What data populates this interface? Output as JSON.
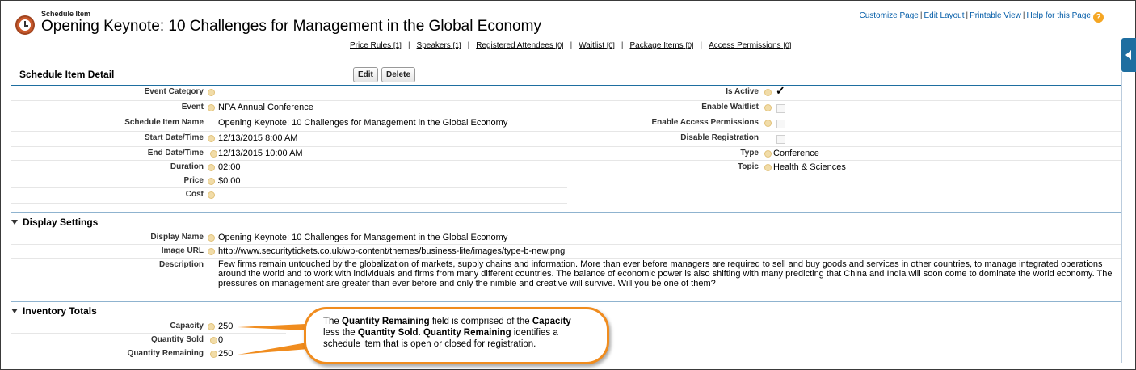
{
  "header": {
    "object_type": "Schedule Item",
    "title": "Opening Keynote: 10 Challenges for Management in the Global Economy",
    "links": [
      "Customize Page",
      "Edit Layout",
      "Printable View",
      "Help for this Page"
    ],
    "help_icon": "?"
  },
  "related_lists": [
    {
      "label": "Price Rules",
      "count": "[1]"
    },
    {
      "label": "Speakers",
      "count": "[1]"
    },
    {
      "label": "Registered Attendees",
      "count": "[0]"
    },
    {
      "label": "Waitlist",
      "count": "[0]"
    },
    {
      "label": "Package Items",
      "count": "[0]"
    },
    {
      "label": "Access Permissions",
      "count": "[0]"
    }
  ],
  "detail": {
    "title": "Schedule Item Detail",
    "edit_label": "Edit",
    "delete_label": "Delete",
    "left_fields": [
      {
        "label": "Event Category",
        "value": ""
      },
      {
        "label": "Event",
        "value": "NPA Annual Conference"
      },
      {
        "label": "Schedule Item Name",
        "value": "Opening Keynote: 10 Challenges for Management in the Global Economy"
      },
      {
        "label": "Start Date/Time",
        "value": "12/13/2015 8:00 AM"
      },
      {
        "label": "End Date/Time",
        "value": "12/13/2015 10:00 AM"
      },
      {
        "label": "Duration",
        "value": "02:00"
      },
      {
        "label": "Price",
        "value": "$0.00"
      },
      {
        "label": "Cost",
        "value": ""
      }
    ],
    "right_fields": [
      {
        "label": "Is Active",
        "checked": true
      },
      {
        "label": "Enable Waitlist",
        "checked": false
      },
      {
        "label": "Enable Access Permissions",
        "checked": false
      },
      {
        "label": "Disable Registration",
        "checked": false
      },
      {
        "label": "Type",
        "value": "Conference"
      },
      {
        "label": "Topic",
        "value": "Health & Sciences"
      }
    ]
  },
  "display_settings": {
    "title": "Display Settings",
    "display_name_label": "Display Name",
    "display_name": "Opening Keynote: 10 Challenges for Management in the Global Economy",
    "image_url_label": "Image URL",
    "image_url": "http://www.securitytickets.co.uk/wp-content/themes/business-lite/images/type-b-new.png",
    "description_label": "Description",
    "description": "Few firms remain untouched by the globalization of markets, supply chains and information. More than ever before managers are required to sell and buy goods and services in other countries, to manage integrated operations around the world and to work with individuals and firms from many different countries. The balance of economic power is also shifting with many predicting that China and India will soon come to dominate the world economy. The pressures on management are greater than ever before and only the nimble and creative will survive. Will you be one of them?"
  },
  "inventory": {
    "title": "Inventory Totals",
    "capacity_label": "Capacity",
    "capacity": "250",
    "sold_label": "Quantity Sold",
    "sold": "0",
    "remaining_label": "Quantity Remaining",
    "remaining": "250"
  },
  "callout": {
    "t1": "The ",
    "b1": "Quantity Remaining",
    "t2": " field is comprised of the ",
    "b2": "Capacity",
    "t3": " less the ",
    "b3": "Quantity Sold",
    "t4": ". ",
    "b4": "Quantity Remaining",
    "t5": " identifies a schedule item that is open or closed for registration."
  },
  "colors": {
    "accent": "#1e6ea0",
    "callout": "#f08c1e",
    "link": "#015ba7"
  }
}
